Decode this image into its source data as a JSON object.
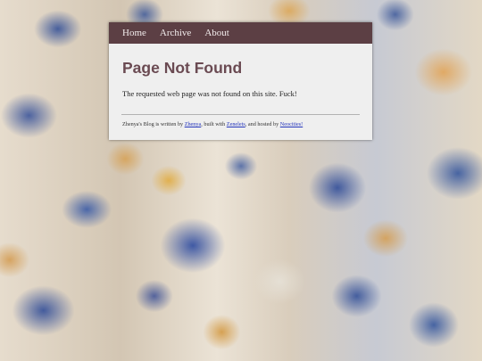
{
  "nav": {
    "items": [
      {
        "label": "Home"
      },
      {
        "label": "Archive"
      },
      {
        "label": "About"
      }
    ]
  },
  "main": {
    "title": "Page Not Found",
    "message": "The requested web page was not found on this site. Fuck!"
  },
  "footer": {
    "text_1": "Zhenya's Blog is written by ",
    "link_author": "Zhenya",
    "text_2": ", built with ",
    "link_builder": "Zenelets",
    "text_3": ", and hosted by ",
    "link_host": "Neocities!"
  },
  "colors": {
    "navbar_bg": "#5c3f44",
    "title": "#6a4a52",
    "link": "#2233bb",
    "content_bg": "#efefef"
  }
}
